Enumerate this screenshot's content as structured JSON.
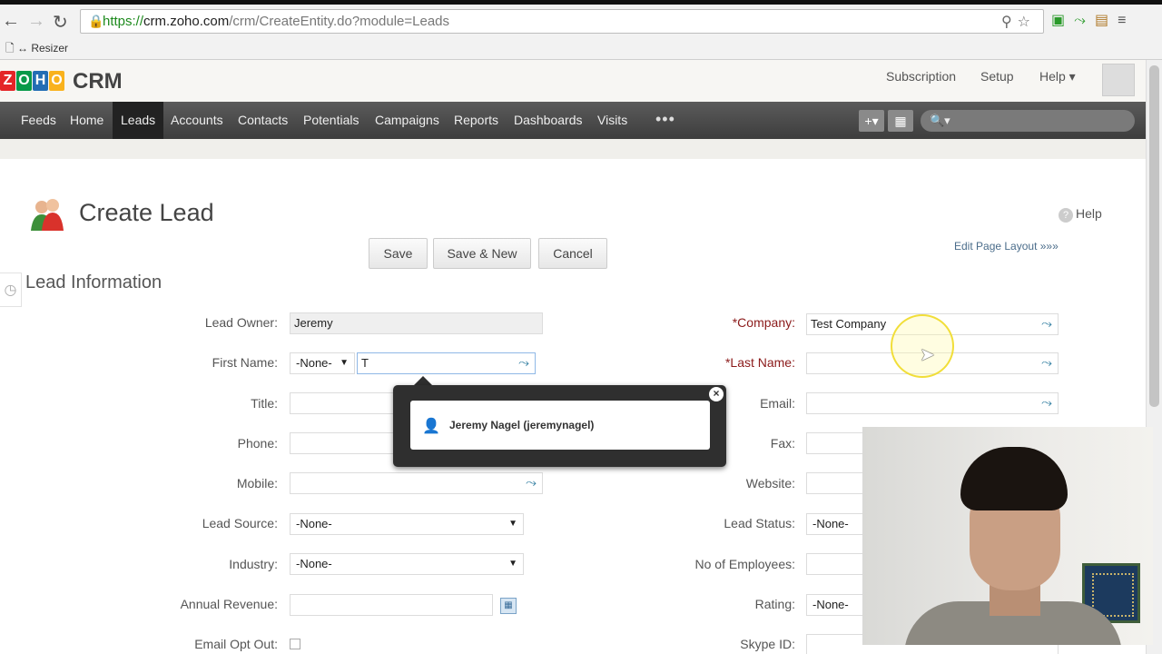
{
  "browser": {
    "url_https": "https://",
    "url_host": "crm.zoho.com",
    "url_path": "/crm/CreateEntity.do?module=Leads",
    "bookmark": "↔ Resizer"
  },
  "header": {
    "logo_letters": [
      "Z",
      "O",
      "H",
      "O"
    ],
    "product": "CRM",
    "subscription": "Subscription",
    "setup": "Setup",
    "help": "Help ▾"
  },
  "nav": {
    "items": [
      "Feeds",
      "Home",
      "Leads",
      "Accounts",
      "Contacts",
      "Potentials",
      "Campaigns",
      "Reports",
      "Dashboards",
      "Visits"
    ],
    "active": "Leads",
    "more": "•••",
    "add_icon": "+▾",
    "calendar_icon": "▦",
    "search_icon": "🔍▾"
  },
  "page": {
    "title": "Create Lead",
    "help": "Help",
    "edit_layout": "Edit Page Layout »»»",
    "buttons": {
      "save": "Save",
      "save_new": "Save & New",
      "cancel": "Cancel"
    },
    "section": "Lead Information"
  },
  "form": {
    "left": {
      "lead_owner": {
        "label": "Lead Owner:",
        "value": "Jeremy"
      },
      "first_name": {
        "label": "First Name:",
        "salutation": "-None-",
        "value": "T"
      },
      "title": {
        "label": "Title:"
      },
      "phone": {
        "label": "Phone:"
      },
      "mobile": {
        "label": "Mobile:"
      },
      "lead_source": {
        "label": "Lead Source:",
        "value": "-None-"
      },
      "industry": {
        "label": "Industry:",
        "value": "-None-"
      },
      "annual_revenue": {
        "label": "Annual Revenue:"
      },
      "email_opt_out": {
        "label": "Email Opt Out:"
      }
    },
    "right": {
      "company": {
        "label": "*Company:",
        "value": "Test Company"
      },
      "last_name": {
        "label": "*Last Name:"
      },
      "email": {
        "label": "Email:"
      },
      "fax": {
        "label": "Fax:"
      },
      "website": {
        "label": "Website:"
      },
      "lead_status": {
        "label": "Lead Status:",
        "value": "-None-"
      },
      "employees": {
        "label": "No of Employees:"
      },
      "rating": {
        "label": "Rating:",
        "value": "-None-"
      },
      "skype": {
        "label": "Skype ID:"
      }
    }
  },
  "autocomplete": {
    "suggestion": "Jeremy Nagel (jeremynagel)",
    "close": "×"
  },
  "colors": {
    "nav_bg": "#4a4a4a",
    "required_label": "#8b1a1a",
    "lookup_icon": "#2b7a9e",
    "zoho_logo": [
      "#e42527",
      "#f9b21d",
      "#089949",
      "#226db4"
    ]
  }
}
